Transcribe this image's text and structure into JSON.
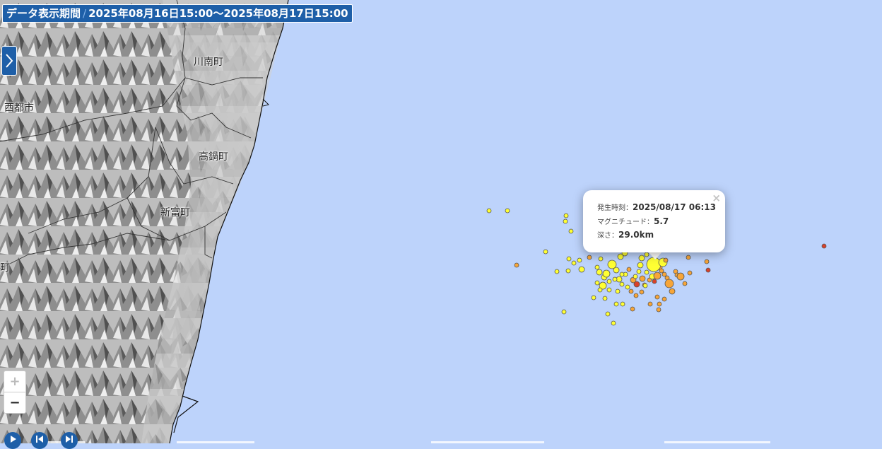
{
  "period": {
    "label": "データ表示期間",
    "range": "2025年08月16日15:00〜2025年08月17日15:00"
  },
  "towns": {
    "kawaminami": "川南町",
    "saito": "西都市",
    "takanabe": "高鍋町",
    "shintomi": "新富町",
    "edge": "町"
  },
  "zoom": {
    "in": "+",
    "out": "−"
  },
  "popup": {
    "time_label": "発生時刻：",
    "time_value": "2025/08/17 06:13",
    "mag_label": "マグニチュード：",
    "mag_value": "5.7",
    "depth_label": "深さ：",
    "depth_value": "29.0km",
    "close": "×"
  },
  "colors": {
    "sea": "#bdd3fb",
    "land": "#c8c8c8",
    "accent": "#1e5fa8",
    "quake_shallow": "#ffff33",
    "quake_mid": "#f7a538",
    "quake_deep": "#d9412a"
  },
  "icons": {
    "panel_toggle": "chevron-right-icon",
    "play": "play-icon",
    "prev": "skip-back-icon",
    "next": "skip-forward-icon"
  }
}
